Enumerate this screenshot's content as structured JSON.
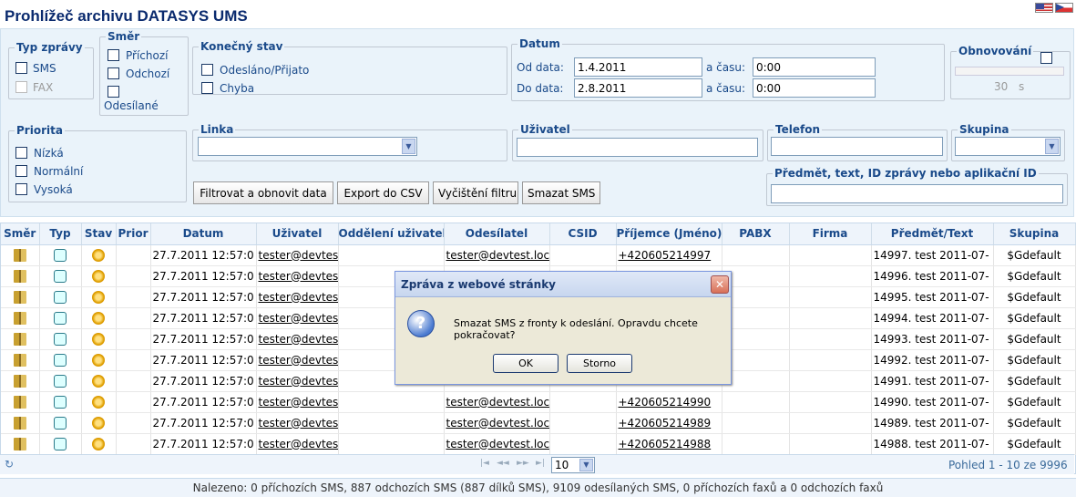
{
  "page": {
    "title": "Prohlížeč archivu DATASYS UMS"
  },
  "filters": {
    "typ": {
      "legend": "Typ zprávy",
      "sms": "SMS",
      "fax": "FAX"
    },
    "smer": {
      "legend": "Směr",
      "prichozi": "Příchozí",
      "odchozi": "Odchozí",
      "odesilane": "Odesílané"
    },
    "konecny": {
      "legend": "Konečný stav",
      "odeslano": "Odesláno/Přijato",
      "chyba": "Chyba"
    },
    "datum": {
      "legend": "Datum",
      "od_label": "Od data:",
      "od_value": "1.4.2011",
      "do_label": "Do data:",
      "do_value": "2.8.2011",
      "cas_label": "a času:",
      "cas_od": "0:00",
      "cas_do": "0:00"
    },
    "obnov": {
      "legend": "Obnovování",
      "seconds": "30",
      "unit": "s"
    },
    "priorita": {
      "legend": "Priorita",
      "nizka": "Nízká",
      "normalni": "Normální",
      "vysoka": "Vysoká"
    },
    "linka": {
      "legend": "Linka"
    },
    "uzivatel": {
      "legend": "Uživatel"
    },
    "telefon": {
      "legend": "Telefon"
    },
    "skupina": {
      "legend": "Skupina"
    },
    "predmet": {
      "legend": "Předmět, text, ID zprávy nebo aplikační ID"
    }
  },
  "buttons": {
    "filter": "Filtrovat a obnovit data",
    "export": "Export do CSV",
    "clear": "Vyčištění filtru",
    "delete": "Smazat SMS"
  },
  "table": {
    "columns": [
      "Směr",
      "Typ",
      "Stav",
      "Prior",
      "Datum",
      "Uživatel",
      "Oddělení uživatel",
      "Odesílatel",
      "CSID",
      "Příjemce (Jméno)",
      "PABX",
      "Firma",
      "Předmět/Text",
      "Skupina"
    ],
    "rows": [
      {
        "datum": "27.7.2011 12:57:0",
        "uzivatel": "tester@devtest",
        "odesilatel": "tester@devtest.loca",
        "prijemce": "+420605214997",
        "predmet": "14997. test 2011-07-",
        "skupina": "$Gdefault"
      },
      {
        "datum": "27.7.2011 12:57:0",
        "uzivatel": "tester@devtest",
        "odesilatel": "",
        "prijemce": "",
        "predmet": "14996. test 2011-07-",
        "skupina": "$Gdefault"
      },
      {
        "datum": "27.7.2011 12:57:0",
        "uzivatel": "tester@devtest",
        "odesilatel": "",
        "prijemce": "",
        "predmet": "14995. test 2011-07-",
        "skupina": "$Gdefault"
      },
      {
        "datum": "27.7.2011 12:57:0",
        "uzivatel": "tester@devtest",
        "odesilatel": "",
        "prijemce": "",
        "predmet": "14994. test 2011-07-",
        "skupina": "$Gdefault"
      },
      {
        "datum": "27.7.2011 12:57:0",
        "uzivatel": "tester@devtest",
        "odesilatel": "",
        "prijemce": "",
        "predmet": "14993. test 2011-07-",
        "skupina": "$Gdefault"
      },
      {
        "datum": "27.7.2011 12:57:0",
        "uzivatel": "tester@devtest",
        "odesilatel": "",
        "prijemce": "",
        "predmet": "14992. test 2011-07-",
        "skupina": "$Gdefault"
      },
      {
        "datum": "27.7.2011 12:57:0",
        "uzivatel": "tester@devtest",
        "odesilatel": "",
        "prijemce": "",
        "predmet": "14991. test 2011-07-",
        "skupina": "$Gdefault"
      },
      {
        "datum": "27.7.2011 12:57:0",
        "uzivatel": "tester@devtest",
        "odesilatel": "tester@devtest.loca",
        "prijemce": "+420605214990",
        "predmet": "14990. test 2011-07-",
        "skupina": "$Gdefault"
      },
      {
        "datum": "27.7.2011 12:57:0",
        "uzivatel": "tester@devtest",
        "odesilatel": "tester@devtest.loca",
        "prijemce": "+420605214989",
        "predmet": "14989. test 2011-07-",
        "skupina": "$Gdefault"
      },
      {
        "datum": "27.7.2011 12:57:0",
        "uzivatel": "tester@devtest",
        "odesilatel": "tester@devtest.loca",
        "prijemce": "+420605214988",
        "predmet": "14988. test 2011-07-",
        "skupina": "$Gdefault"
      }
    ]
  },
  "pager": {
    "page_size": "10",
    "summary": "Pohled 1 - 10 ze 9996"
  },
  "status": "Nalezeno: 0 příchozích SMS, 887 odchozích SMS (887 dílků SMS), 9109 odesílaných SMS, 0 příchozích faxů a 0 odchozích faxů",
  "dialog": {
    "title": "Zpráva z webové stránky",
    "message": "Smazat SMS z fronty k odeslání. Opravdu chcete pokračovat?",
    "ok": "OK",
    "cancel": "Storno"
  }
}
